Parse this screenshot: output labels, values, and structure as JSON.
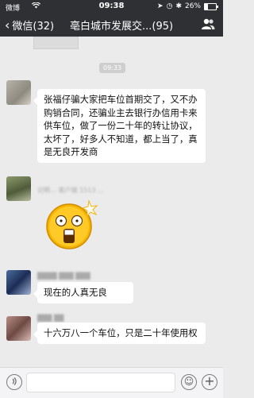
{
  "status_bar": {
    "carrier": "微博",
    "time": "09:38",
    "battery": "26%",
    "battery_level": 0.26
  },
  "nav": {
    "back_label": "微信(32)",
    "title": "亳白城市发展交...(95)"
  },
  "chat": {
    "timestamp": "09:33",
    "messages": [
      {
        "text": "张福仔骗大家把车位首期交了，又不办购销合同，还骗业主去银行办信用卡来供车位，做了一份二十年的转让协议，太坏了，好多人不知道，都上当了，真是无良开发商"
      },
      {
        "nickname": "记啊… 客户端 1513 …",
        "emoji": "shocked-emoji"
      },
      {
        "text": "现在的人真无良"
      },
      {
        "text": "十六万八一个车位，只是二十年使用权"
      }
    ]
  },
  "input_bar": {
    "voice_icon": "voice-icon",
    "emoji_icon": "emoji-icon",
    "plus_icon": "plus-icon"
  }
}
